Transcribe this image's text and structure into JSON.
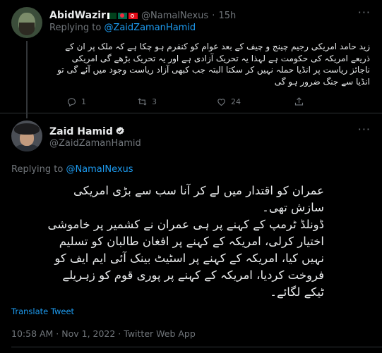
{
  "reply_tweet": {
    "display_name": "AbidWazir",
    "handle": "@NamalNexus",
    "separator": "·",
    "time_ago": "15h",
    "replying_to_label": "Replying to",
    "replying_to_handle": "@ZaidZamanHamid",
    "text": "زید حامد امریکی رجیم چینج و چیف کے بعد عوام کو کنفرم ہو چکا ہے کہ ملک پر ان کے ذریعے امریکہ کی حکومت ہے لہذا یہ تحریک آزادی ہے اور یہ تحریک بڑھے گی امریکی ناجائز ریاست پر انڈیا حملہ نہیں کر سکتا البتہ جب کبھی آزاد ریاست وجود میں آئے گی تو انڈیا سے جنگ ضرور ہو گی",
    "actions": {
      "reply_count": "1",
      "retweet_count": "3",
      "like_count": "24"
    },
    "icons": [
      "reply-icon",
      "retweet-icon",
      "like-icon",
      "share-icon"
    ]
  },
  "main_tweet": {
    "display_name": "Zaid Hamid",
    "handle": "@ZaidZamanHamid",
    "more_label": "···",
    "replying_to_label": "Replying to",
    "replying_to_handle": "@NamalNexus",
    "text": "عمران کو اقتدار میں لے کر آنا سب سے بڑی امریکی سازش تھی۔\nڈونلڈ ٹرمپ کے کہنے پر ہی عمران نے کشمیر پر خاموشی اختیار کرلی، امریکہ کے کہنے پر افغان طالبان کو تسلیم نہیں کیا، امریکہ کے کہنے پر اسٹیٹ بینک آئی ایم ایف کو فروخت کردیا، امریکہ کے کہنے پر پوری قوم کو زہریلے ٹیکے لگائے۔",
    "translate_label": "Translate Tweet",
    "timestamp": "10:58 AM · Nov 1, 2022 · Twitter Web App"
  },
  "colors": {
    "background": "#000000",
    "text": "#e7e9ea",
    "muted": "#71767b",
    "accent": "#1d9bf0",
    "divider": "#2f3336"
  }
}
